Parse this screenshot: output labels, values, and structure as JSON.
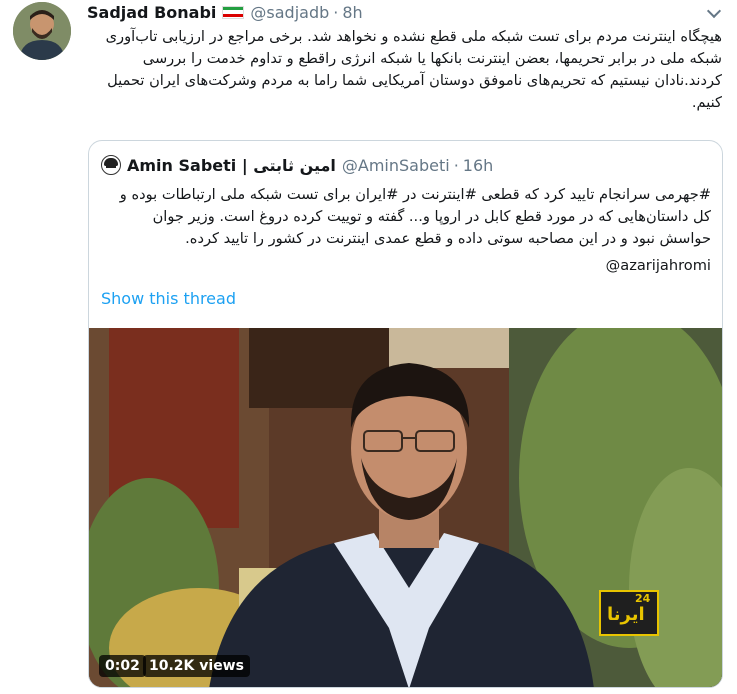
{
  "tweet": {
    "author_name": "Sadjad Bonabi",
    "handle": "@sadjadb",
    "separator": "·",
    "time": "8h",
    "text": "هیچگاه اینترنت مردم برای تست شبکه ملی قطع نشده و نخواهد شد. برخی مراجع در ارزیابی تاب‌آوری شبکه ملی در برابر تحریمها، بعضن اینترنت بانکها یا شبکه انرژی راقطع و تداوم خدمت را بررسی کردند.نادان نیستیم که تحریم‌های ناموفق دوستان آمریکایی شما راما به مردم وشرکت‌های ایران تحمیل کنیم."
  },
  "quoted_tweet": {
    "author_name": "Amin Sabeti | امین ثابتی",
    "handle": "@AminSabeti",
    "separator": "·",
    "time": "16h",
    "text": "#جهرمی سرانجام تایید کرد که قطعی #اینترنت در #ایران برای تست شبکه ملی ارتباطات بوده و کل داستان‌هایی که در مورد قطع کابل در اروپا و... گفته و توییت کرده دروغ است. وزیر جوان حواسش نبود و در این مصاحبه سوتی داده و قطع عمدی اینترنت در کشور را تایید کرده.",
    "mention": "@azarijahromi",
    "show_thread": "Show this thread"
  },
  "video": {
    "time": "0:02",
    "views": "10.2K views",
    "logo_number": "24",
    "logo_script": "ایرنا"
  },
  "icons": {
    "caret": "chevron-down-icon",
    "flag": "iran-flag-icon"
  },
  "colors": {
    "link": "#1da1f2",
    "secondary_text": "#657786",
    "border": "#ccd6dd"
  }
}
